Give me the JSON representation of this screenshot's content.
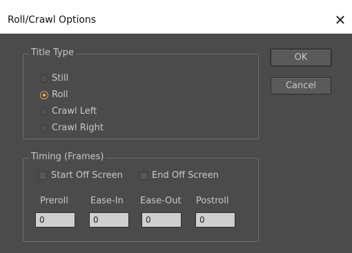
{
  "window": {
    "title": "Roll/Crawl Options",
    "close_glyph": "✕"
  },
  "title_type": {
    "label": "Title Type",
    "options": [
      {
        "label": "Still",
        "selected": false
      },
      {
        "label": "Roll",
        "selected": true
      },
      {
        "label": "Crawl Left",
        "selected": false
      },
      {
        "label": "Crawl Right",
        "selected": false
      }
    ]
  },
  "timing": {
    "label": "Timing (Frames)",
    "start_off_screen": {
      "label": "Start Off Screen",
      "checked": false
    },
    "end_off_screen": {
      "label": "End Off Screen",
      "checked": false
    },
    "fields": [
      {
        "label": "Preroll",
        "value": "0"
      },
      {
        "label": "Ease-In",
        "value": "0"
      },
      {
        "label": "Ease-Out",
        "value": "0"
      },
      {
        "label": "Postroll",
        "value": "0"
      }
    ]
  },
  "buttons": {
    "ok": "OK",
    "cancel": "Cancel"
  },
  "colors": {
    "panel": "#4b4b4b",
    "accent": "#f0b35a"
  }
}
